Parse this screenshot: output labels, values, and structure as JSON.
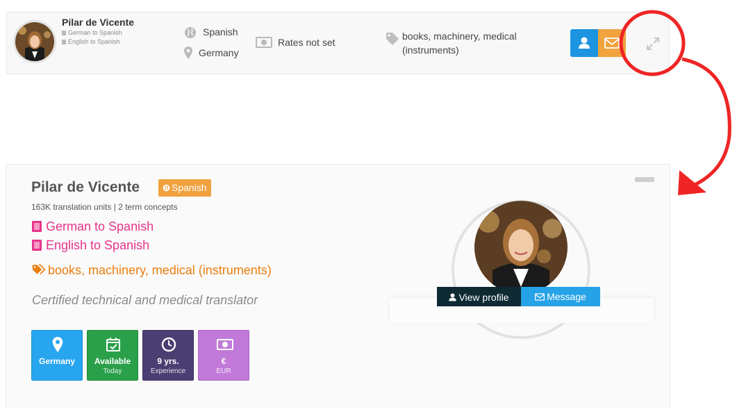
{
  "compact": {
    "name": "Pilar de Vicente",
    "pairs": [
      "German to Spanish",
      "English to Spanish"
    ],
    "native_language": "Spanish",
    "country": "Germany",
    "rates": "Rates not set",
    "subjects_line1": "books, machinery, medical",
    "subjects_line2": "(instruments)",
    "icons": {
      "profile": "user-icon",
      "message": "envelope-icon",
      "expand": "expand-icon",
      "globe": "globe-icon",
      "location": "map-marker-icon",
      "rates": "money-icon",
      "tags": "tag-icon"
    }
  },
  "expanded": {
    "name": "Pilar de Vicente",
    "language_badge": "Spanish",
    "stats": "163K translation units | 2 term concepts",
    "pairs": [
      "German to Spanish",
      "English to Spanish"
    ],
    "subjects": "books, machinery, medical (instruments)",
    "tagline": "Certified technical and medical translator",
    "tiles": [
      {
        "label": "Germany",
        "sub": "",
        "icon": "map-marker-icon",
        "color": "#27a5ef"
      },
      {
        "label": "Available",
        "sub": "Today",
        "icon": "calendar-check-icon",
        "color": "#2aa04a"
      },
      {
        "label": "9 yrs.",
        "sub": "Experience",
        "icon": "clock-icon",
        "color": "#4a3e72"
      },
      {
        "label": "€",
        "sub": "EUR",
        "icon": "money-icon",
        "color": "#c17ad9"
      }
    ],
    "view_profile": "View profile",
    "message": "Message"
  },
  "colors": {
    "pink": "#e8348a",
    "orange": "#ec7d0f",
    "annotation_red": "#ef2525"
  }
}
